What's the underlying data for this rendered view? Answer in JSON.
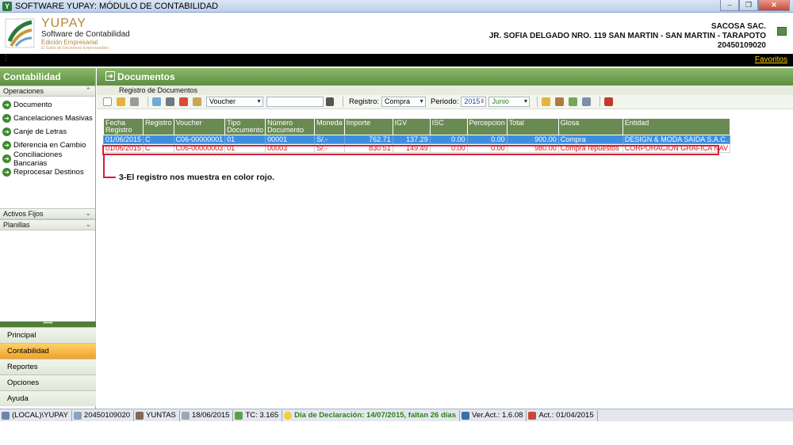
{
  "window": {
    "title": "SOFTWARE YUPAY: MÓDULO DE CONTABILIDAD",
    "buttons": [
      "minimize",
      "restore",
      "close"
    ]
  },
  "header": {
    "brand_name": "YUPAY",
    "brand_sub": "Software de Contabilidad",
    "brand_edition": "Edición Empresarial",
    "brand_tag": "El Sabio de Decisiones Empresariales",
    "company_name": "SACOSA SAC.",
    "company_address": "JR. SOFIA DELGADO NRO. 119 SAN MARTIN - SAN MARTIN - TARAPOTO",
    "company_ruc": "20450109020"
  },
  "favbar": {
    "favorites_label": "Favoritos"
  },
  "sidebar": {
    "title": "Contabilidad",
    "operaciones_label": "Operaciones",
    "items": [
      {
        "label": "Documento"
      },
      {
        "label": "Cancelaciones Masivas"
      },
      {
        "label": "Canje de Letras"
      },
      {
        "label": "Diferencia en Cambio"
      },
      {
        "label": "Conciliaciones Bancarias"
      },
      {
        "label": "Reprocesar Destinos"
      }
    ],
    "activos_label": "Activos Fijos",
    "planillas_label": "Planillas",
    "nav": [
      {
        "label": "Principal",
        "active": false
      },
      {
        "label": "Contabilidad",
        "active": true
      },
      {
        "label": "Reportes",
        "active": false
      },
      {
        "label": "Opciones",
        "active": false
      },
      {
        "label": "Ayuda",
        "active": false
      }
    ]
  },
  "main": {
    "title": "Documentos",
    "subheader": "Registro de Documentos",
    "toolbar": {
      "voucher_combo": "Voucher",
      "search_value": "",
      "registro_label": "Registro:",
      "registro_value": "Compra",
      "periodo_label": "Periodo:",
      "periodo_year": "2015",
      "periodo_month": "Junio"
    },
    "table": {
      "headers": [
        "Fecha Registro",
        "Registro",
        "Voucher",
        "Tipo Documento",
        "Número Documento",
        "Moneda",
        "Importe",
        "IGV",
        "ISC",
        "Percepcion",
        "Total",
        "Glosa",
        "Entidad"
      ],
      "rows": [
        [
          "01/06/2015",
          "C",
          "C06-00000001",
          "01",
          "00001",
          "S/.-",
          "762.71",
          "137.29",
          "0.00",
          "0.00",
          "900.00",
          "Compra",
          "DESIGN & MODA SAIDA S.A.C."
        ],
        [
          "01/06/2015",
          "C",
          "C06-00000003",
          "01",
          "00003",
          "S/.-",
          "830.51",
          "149.49",
          "0.00",
          "0.00",
          "980.00",
          "Compra repuestos",
          "CORPORACION GRAFICA NAV"
        ]
      ]
    },
    "annotation": "3-El registro nos muestra en color rojo."
  },
  "statusbar": {
    "server": "(LOCAL)\\YUPAY",
    "ruc": "20450109020",
    "user": "YUNTAS",
    "date": "18/06/2015",
    "tc": "TC: 3.165",
    "declaracion": "Día de Declaración: 14/07/2015, faltan 26 días",
    "version": "Ver.Act.: 1.6.08",
    "act": "Act.: 01/04/2015"
  },
  "colors": {
    "green_header": "#5d8e3f",
    "selected_row": "#3d8ee0",
    "highlight_red": "#d41f35",
    "active_nav": "#f0a22a"
  }
}
